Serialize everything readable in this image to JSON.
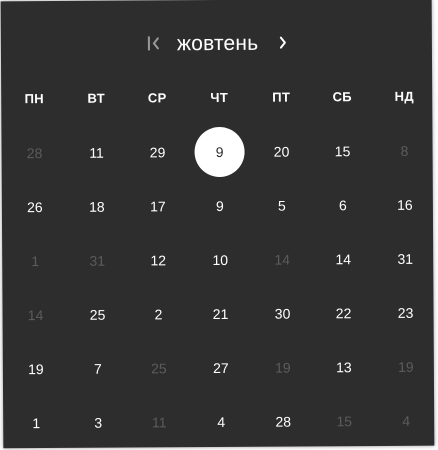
{
  "header": {
    "month": "жовтень"
  },
  "weekdays": [
    "ПН",
    "ВТ",
    "СР",
    "ЧТ",
    "ПТ",
    "СБ",
    "НД"
  ],
  "rows": [
    [
      {
        "day": "28",
        "muted": true
      },
      {
        "day": "11",
        "muted": false
      },
      {
        "day": "29",
        "muted": false
      },
      {
        "day": "9",
        "muted": false,
        "selected": true
      },
      {
        "day": "20",
        "muted": false
      },
      {
        "day": "15",
        "muted": false
      },
      {
        "day": "8",
        "muted": true
      }
    ],
    [
      {
        "day": "26",
        "muted": false
      },
      {
        "day": "18",
        "muted": false
      },
      {
        "day": "17",
        "muted": false
      },
      {
        "day": "9",
        "muted": false
      },
      {
        "day": "5",
        "muted": false
      },
      {
        "day": "6",
        "muted": false
      },
      {
        "day": "16",
        "muted": false
      }
    ],
    [
      {
        "day": "1",
        "muted": true
      },
      {
        "day": "31",
        "muted": true
      },
      {
        "day": "12",
        "muted": false
      },
      {
        "day": "10",
        "muted": false
      },
      {
        "day": "14",
        "muted": true
      },
      {
        "day": "14",
        "muted": false
      },
      {
        "day": "31",
        "muted": false
      }
    ],
    [
      {
        "day": "14",
        "muted": true
      },
      {
        "day": "25",
        "muted": false
      },
      {
        "day": "2",
        "muted": false
      },
      {
        "day": "21",
        "muted": false
      },
      {
        "day": "30",
        "muted": false
      },
      {
        "day": "22",
        "muted": false
      },
      {
        "day": "23",
        "muted": false
      }
    ],
    [
      {
        "day": "19",
        "muted": false
      },
      {
        "day": "7",
        "muted": false
      },
      {
        "day": "25",
        "muted": true
      },
      {
        "day": "27",
        "muted": false
      },
      {
        "day": "19",
        "muted": true
      },
      {
        "day": "13",
        "muted": false
      },
      {
        "day": "19",
        "muted": true
      }
    ],
    [
      {
        "day": "1",
        "muted": false
      },
      {
        "day": "3",
        "muted": false
      },
      {
        "day": "11",
        "muted": true
      },
      {
        "day": "4",
        "muted": false
      },
      {
        "day": "28",
        "muted": false
      },
      {
        "day": "15",
        "muted": true
      },
      {
        "day": "4",
        "muted": true
      }
    ]
  ],
  "colors": {
    "background": "#2d2d2d",
    "text": "#ffffff",
    "muted_text": "#5c5c5c",
    "selected_fill": "#ffffff"
  }
}
